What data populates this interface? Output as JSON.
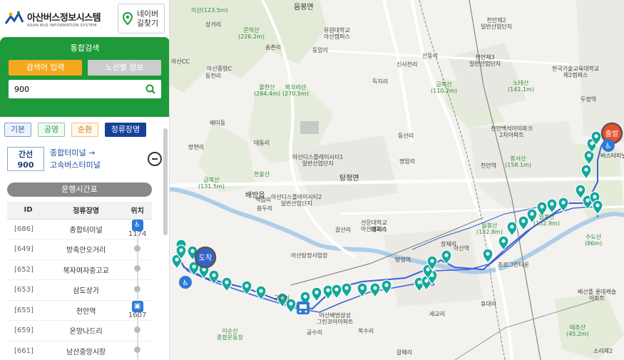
{
  "header": {
    "logo_title": "아산버스정보시스템",
    "logo_sub": "ASAN BUS INFORMATION  SYSTEM",
    "naver_label": "네이버 길찾기"
  },
  "search": {
    "title": "통합검색",
    "tab_keyword": "검색어 입력",
    "tab_route": "노선별 정보",
    "value": "900",
    "search_icon": "search-icon"
  },
  "filters": {
    "basic": "기본",
    "gong": "공영",
    "sun": "순환",
    "stop": "정류장명"
  },
  "route": {
    "type": "간선",
    "number": "900",
    "from": "종합터미널 →",
    "to": "고속버스터미널"
  },
  "timetable_label": "운행시간표",
  "table": {
    "headers": [
      "ID",
      "정류장명",
      "위치"
    ],
    "rows": [
      {
        "id": "[686]",
        "name": "종합터미널",
        "pos_type": "wheelchair",
        "pos_num": "1174"
      },
      {
        "id": "[649]",
        "name": "방축안오거리",
        "pos_type": "dot",
        "pos_num": ""
      },
      {
        "id": "[652]",
        "name": "복자여자중고교",
        "pos_type": "dot",
        "pos_num": ""
      },
      {
        "id": "[653]",
        "name": "삼도상가",
        "pos_type": "dot",
        "pos_num": ""
      },
      {
        "id": "[655]",
        "name": "천안역",
        "pos_type": "bus",
        "pos_num": "1607"
      },
      {
        "id": "[659]",
        "name": "온양나드리",
        "pos_type": "dot",
        "pos_num": ""
      },
      {
        "id": "[661]",
        "name": "남산중앙시장",
        "pos_type": "dot",
        "pos_num": ""
      }
    ]
  },
  "map": {
    "badge_start": "출발",
    "badge_end": "도착",
    "terminal_label": "버스터미널",
    "labels": [
      {
        "text": "음봉면",
        "cls": "town"
      },
      {
        "text": "탕정면",
        "cls": "town"
      },
      {
        "text": "배방읍",
        "cls": "town"
      },
      {
        "text": "이산(123.5m)",
        "cls": "mt"
      },
      {
        "text": "문익산\n(226.2m)",
        "cls": "mt"
      },
      {
        "text": "물한산\n(284.4m)",
        "cls": "mt"
      },
      {
        "text": "뫼꼬리산\n(270.5m)",
        "cls": "mt"
      },
      {
        "text": "금북산\n(110.2m)",
        "cls": "mt"
      },
      {
        "text": "노태산\n(141.1m)",
        "cls": "mt"
      },
      {
        "text": "봉서산\n(158.1m)",
        "cls": "mt"
      },
      {
        "text": "월봉산\n(132.8m)",
        "cls": "mt"
      },
      {
        "text": "일봉산\n(132.9m)",
        "cls": "mt"
      },
      {
        "text": "태조산\n(45.2m)",
        "cls": "mt"
      },
      {
        "text": "금북산\n(131.5m)",
        "cls": "mt"
      },
      {
        "text": "유원대학교\n아산캠퍼스",
        "cls": "poi"
      },
      {
        "text": "아산CC",
        "cls": "poi"
      },
      {
        "text": "아산디스플레이시티1\n일반산업단지",
        "cls": "poi"
      },
      {
        "text": "아산디스플레이시티2\n일반산업단지",
        "cls": "poi"
      },
      {
        "text": "천안제2\n일반산업단지",
        "cls": "poi"
      },
      {
        "text": "천안제3\n일반산업단지",
        "cls": "poi"
      },
      {
        "text": "선문대학교\n아산캠퍼스",
        "cls": "poi"
      },
      {
        "text": "한국기술교육대학교\n제2캠퍼스",
        "cls": "poi"
      },
      {
        "text": "천안역",
        "cls": "poi"
      },
      {
        "text": "천안백석아이파크\n2차아파트",
        "cls": "poi"
      },
      {
        "text": "아산탕정사업장",
        "cls": "poi"
      },
      {
        "text": "아산배방삼성\n그린코아아파트",
        "cls": "poi"
      },
      {
        "text": "신사천리",
        "cls": "poi"
      },
      {
        "text": "구령리",
        "cls": "poi"
      },
      {
        "text": "공수리",
        "cls": "poi"
      },
      {
        "text": "세교리",
        "cls": "poi"
      },
      {
        "text": "갈매리",
        "cls": "poi"
      },
      {
        "text": "휴대리",
        "cls": "poi"
      },
      {
        "text": "복수리",
        "cls": "poi"
      },
      {
        "text": "갈산리",
        "cls": "poi"
      },
      {
        "text": "매곡리",
        "cls": "poi"
      },
      {
        "text": "장재리",
        "cls": "poi"
      },
      {
        "text": "아산역",
        "cls": "poi"
      },
      {
        "text": "탕정역",
        "cls": "poi"
      },
      {
        "text": "배미동",
        "cls": "poi"
      },
      {
        "text": "동천리",
        "cls": "poi"
      },
      {
        "text": "대동리",
        "cls": "poi"
      },
      {
        "text": "방현리",
        "cls": "poi"
      },
      {
        "text": "백암리",
        "cls": "poi"
      },
      {
        "text": "용두리",
        "cls": "poi"
      },
      {
        "text": "동산리",
        "cls": "poi"
      },
      {
        "text": "명암리",
        "cls": "poi"
      },
      {
        "text": "수도산\n(86m)",
        "cls": "mt"
      },
      {
        "text": "이순신\n종합운동장",
        "cls": "mt"
      },
      {
        "text": "조로그린타운",
        "cls": "poi"
      },
      {
        "text": "베산플 롯데캐슬\n아파트",
        "cls": "poi"
      },
      {
        "text": "송촌리",
        "cls": "poi"
      },
      {
        "text": "상거리",
        "cls": "poi"
      },
      {
        "text": "동암리",
        "cls": "poi"
      },
      {
        "text": "아산중앙C",
        "cls": "poi"
      },
      {
        "text": "득지리",
        "cls": "poi"
      },
      {
        "text": "산동리",
        "cls": "poi"
      },
      {
        "text": "한울산",
        "cls": "mt"
      },
      {
        "text": "두정역",
        "cls": "poi"
      },
      {
        "text": "소리제2",
        "cls": "poi"
      }
    ]
  },
  "colors": {
    "green": "#1e9a3b",
    "orange": "#f5a81d",
    "navy": "#14419a",
    "route_blue": "#3c5fd4",
    "stop_teal": "#12a89b"
  }
}
